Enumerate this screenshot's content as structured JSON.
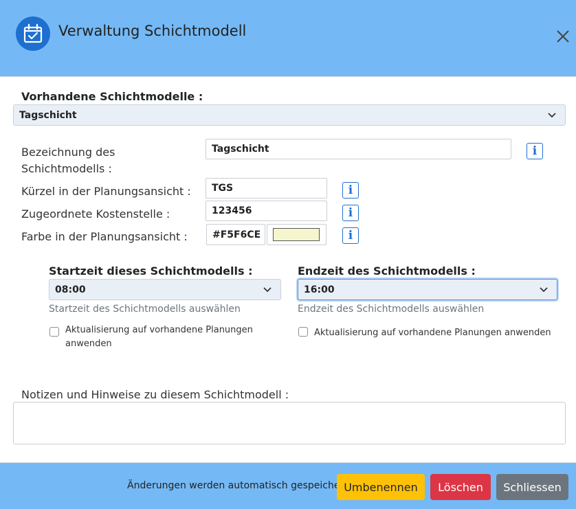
{
  "dialog": {
    "title": "Verwaltung Schichtmodell",
    "icon": "calendar-check-icon",
    "close_icon": "close-icon"
  },
  "existing_models": {
    "label": "Vorhandene Schichtmodelle :",
    "selected": "Tagschicht"
  },
  "form": {
    "name": {
      "label_line1": "Bezeichnung des",
      "label_line2": "Schichtmodells :",
      "value": "Tagschicht"
    },
    "short": {
      "label": "Kürzel in der Planungsansicht :",
      "value": "TGS"
    },
    "cost_center": {
      "label": "Zugeordnete Kostenstelle :",
      "value": "123456"
    },
    "color": {
      "label": "Farbe in der Planungsansicht :",
      "value": "#F5F6CE",
      "swatch_color": "#F5F6CE"
    },
    "info_icon_glyph": "i"
  },
  "start_time": {
    "label": "Startzeit dieses Schichtmodells :",
    "selected": "08:00",
    "help": "Startzeit des Schichtmodells auswählen",
    "checkbox_line1": "Aktualisierung auf vorhandene Planungen",
    "checkbox_line2": "anwenden"
  },
  "end_time": {
    "label": "Endzeit des Schichtmodells :",
    "selected": "16:00",
    "help": "Endzeit des Schichtmodells auswählen",
    "checkbox_label": "Aktualisierung auf vorhandene Planungen anwenden"
  },
  "notes": {
    "label": "Notizen und Hinweise zu diesem Schichtmodell :",
    "value": ""
  },
  "footer": {
    "autosave_text": "Änderungen werden automatisch gespeichert",
    "rename_label": "Umbenennen",
    "delete_label": "Löschen",
    "close_label": "Schliessen"
  },
  "colors": {
    "header_bg": "#74b9f5",
    "accent": "#1e6fd0",
    "warning": "#ffc107",
    "danger": "#dc3545",
    "secondary": "#6c757d"
  }
}
